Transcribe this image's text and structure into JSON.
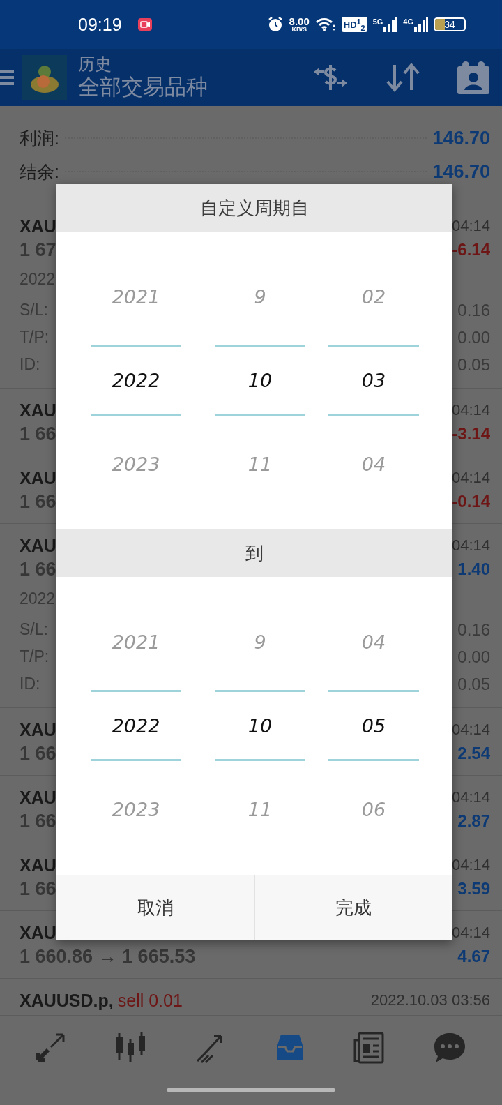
{
  "status_bar": {
    "time": "09:19",
    "net_speed": "8.00",
    "net_unit": "KB/S",
    "hd": "HD$^{1}$$_{2}$",
    "signal_1": "5G",
    "signal_2": "4G",
    "battery": "34"
  },
  "header": {
    "title": "历史",
    "subtitle": "全部交易品种"
  },
  "summary": [
    {
      "label": "利润:",
      "value": "146.70"
    },
    {
      "label": "结余:",
      "value": "146.70"
    }
  ],
  "deals": [
    {
      "symbol": "XAU",
      "time": "04:14",
      "price": "1 67",
      "profit": "-6.14",
      "kind": "loss",
      "date": "2022",
      "details": [
        {
          "label": "S/L:",
          "value": "0.16"
        },
        {
          "label": "T/P:",
          "value": "0.00"
        },
        {
          "label": "ID:",
          "value": "0.05"
        }
      ]
    },
    {
      "symbol": "XAU",
      "time": "04:14",
      "price": "1 66",
      "profit": "-3.14",
      "kind": "loss"
    },
    {
      "symbol": "XAU",
      "time": "04:14",
      "price": "1 66",
      "profit": "-0.14",
      "kind": "loss"
    },
    {
      "symbol": "XAU",
      "time": "04:14",
      "price": "1 66",
      "profit": "1.40",
      "kind": "gain",
      "date": "2022",
      "details": [
        {
          "label": "S/L:",
          "value": "0.16"
        },
        {
          "label": "T/P:",
          "value": "0.00"
        },
        {
          "label": "ID:",
          "value": "0.05"
        }
      ]
    },
    {
      "symbol": "XAU",
      "time": "04:14",
      "price": "1 66",
      "profit": "2.54",
      "kind": "gain"
    },
    {
      "symbol": "XAU",
      "time": "04:14",
      "price": "1 66",
      "profit": "2.87",
      "kind": "gain"
    },
    {
      "symbol": "XAU",
      "time": "04:14",
      "price": "1 66",
      "profit": "3.59",
      "kind": "gain"
    },
    {
      "symbol": "XAU",
      "time": "04:14",
      "price": "1 660.86 → 1 665.53",
      "profit": "4.67",
      "kind": "gain"
    },
    {
      "symbol": "XAUUSD.p,",
      "side": "sell 0.01",
      "time": "2022.10.03 03:56",
      "kind": "loss"
    }
  ],
  "dialog": {
    "title": "自定义周期自",
    "from": [
      {
        "values": [
          {
            "text": "2021",
            "selected": false
          },
          {
            "text": "2022",
            "selected": true
          },
          {
            "text": "2023",
            "selected": false
          }
        ]
      },
      {
        "values": [
          {
            "text": "9",
            "selected": false
          },
          {
            "text": "10",
            "selected": true
          },
          {
            "text": "11",
            "selected": false
          }
        ]
      },
      {
        "values": [
          {
            "text": "02",
            "selected": false
          },
          {
            "text": "03",
            "selected": true
          },
          {
            "text": "04",
            "selected": false
          }
        ]
      }
    ],
    "to_label": "到",
    "to": [
      {
        "values": [
          {
            "text": "2021",
            "selected": false
          },
          {
            "text": "2022",
            "selected": true
          },
          {
            "text": "2023",
            "selected": false
          }
        ]
      },
      {
        "values": [
          {
            "text": "9",
            "selected": false
          },
          {
            "text": "10",
            "selected": true
          },
          {
            "text": "11",
            "selected": false
          }
        ]
      },
      {
        "values": [
          {
            "text": "04",
            "selected": false
          },
          {
            "text": "05",
            "selected": true
          },
          {
            "text": "06",
            "selected": false
          }
        ]
      }
    ],
    "buttons": [
      "取消",
      "完成"
    ]
  },
  "nav": [
    {
      "kind": "trade",
      "selected": false
    },
    {
      "kind": "chart",
      "selected": false
    },
    {
      "kind": "signals",
      "selected": false
    },
    {
      "kind": "history",
      "selected": true
    },
    {
      "kind": "news",
      "selected": false
    },
    {
      "kind": "chat",
      "selected": false
    }
  ]
}
